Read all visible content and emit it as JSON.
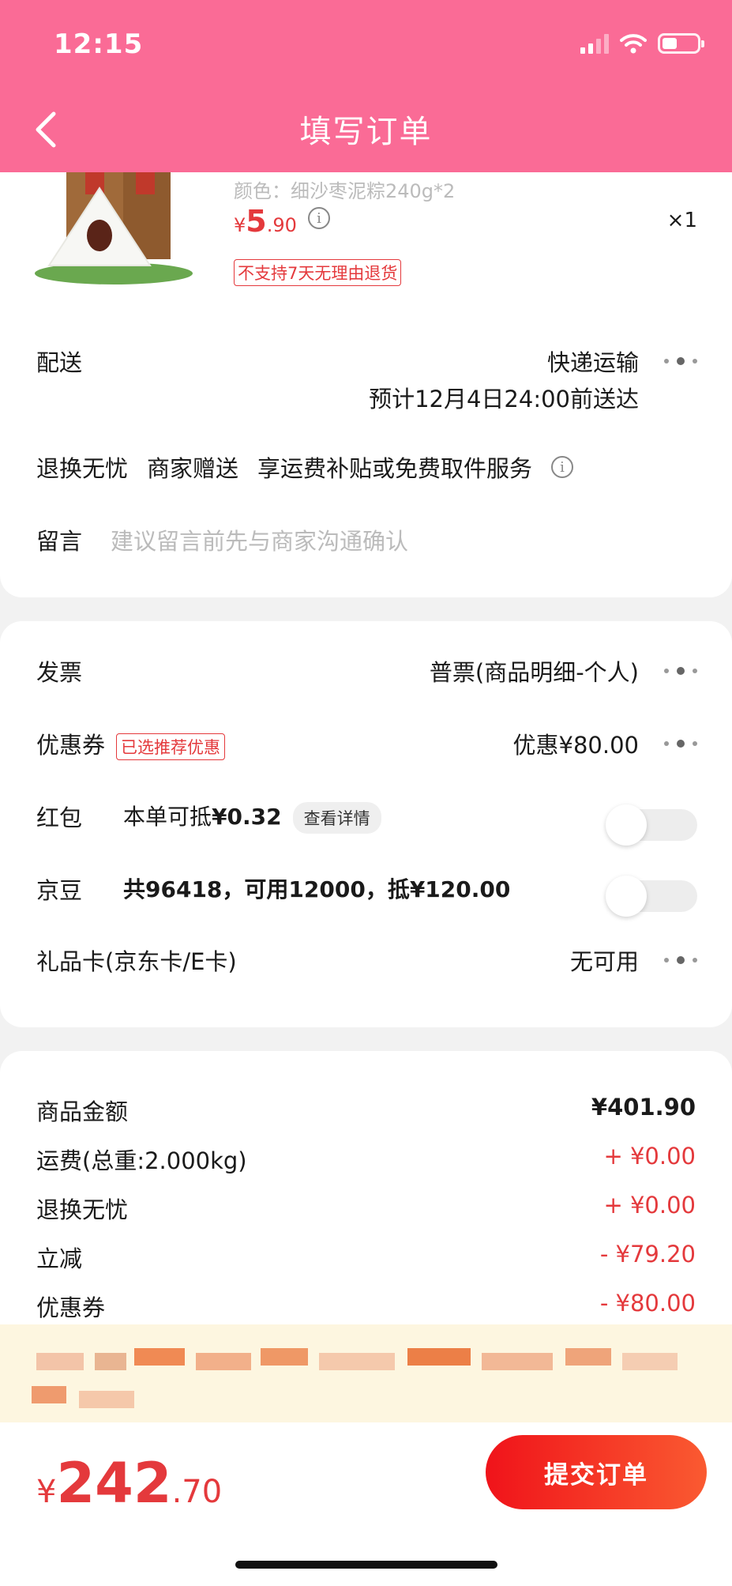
{
  "status_bar": {
    "time": "12:15"
  },
  "header": {
    "title": "填写订单"
  },
  "product": {
    "spec": "颜色：细沙枣泥粽240g*2",
    "price_currency": "¥",
    "price_int": "5",
    "price_dec": ".90",
    "quantity": "×1",
    "return_tag": "不支持7天无理由退货"
  },
  "delivery": {
    "label": "配送",
    "method": "快递运输",
    "eta": "预计12月4日24:00前送达"
  },
  "services": {
    "items": [
      "退换无忧",
      "商家赠送",
      "享运费补贴或免费取件服务"
    ]
  },
  "message": {
    "label": "留言",
    "placeholder": "建议留言前先与商家沟通确认"
  },
  "invoice": {
    "label": "发票",
    "value": "普票(商品明细-个人)"
  },
  "coupon": {
    "label": "优惠券",
    "badge": "已选推荐优惠",
    "value": "优惠¥80.00"
  },
  "red_packet": {
    "label": "红包",
    "value_prefix": "本单可抵",
    "value_amount": "¥0.32",
    "detail_button": "查看详情",
    "enabled": false
  },
  "jd_beans": {
    "label": "京豆",
    "value": "共96418，可用12000，抵¥120.00",
    "enabled": false
  },
  "gift_card": {
    "label": "礼品卡(京东卡/E卡)",
    "value": "无可用"
  },
  "summary": [
    {
      "label": "商品金额",
      "value": "¥401.90"
    },
    {
      "label": "运费(总重:2.000kg)",
      "value": "+ ¥0.00"
    },
    {
      "label": "退换无忧",
      "value": "+ ¥0.00"
    },
    {
      "label": "立减",
      "value": "- ¥79.20"
    },
    {
      "label": "优惠券",
      "value": "- ¥80.00"
    }
  ],
  "footer": {
    "total_currency": "¥",
    "total_int": "242",
    "total_dec": ".70",
    "submit_label": "提交订单"
  },
  "colors": {
    "header_bg": "#fa6b96",
    "accent_red": "#e4393c",
    "notice_bg": "#fdf6e0"
  }
}
